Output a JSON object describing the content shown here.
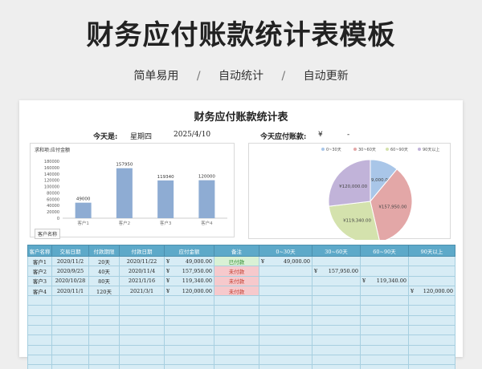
{
  "header": {
    "title": "财务应付账款统计表模板",
    "features": [
      "简单易用",
      "自动统计",
      "自动更新"
    ],
    "separator": "/"
  },
  "sheet": {
    "title": "财务应付账款统计表",
    "today_label": "今天是:",
    "today_weekday": "星期四",
    "today_date": "2025/4/10",
    "due_label": "今天应付账款:",
    "due_currency": "¥",
    "due_value": "-",
    "filter_tag": "客户名称"
  },
  "chart_data": [
    {
      "type": "bar",
      "title": "求和项:应付金额",
      "categories": [
        "客户1",
        "客户2",
        "客户3",
        "客户4"
      ],
      "values": [
        49000,
        157950,
        119340,
        120000
      ],
      "ylim": [
        0,
        180000
      ],
      "yticks": [
        0,
        20000,
        40000,
        60000,
        80000,
        100000,
        120000,
        140000,
        160000,
        180000
      ],
      "grid": false,
      "bar_color": "#8eacd3"
    },
    {
      "type": "pie",
      "legend": [
        "0~30天",
        "30~60天",
        "60~90天",
        "90天以上"
      ],
      "legend_position": "top",
      "values": [
        49000,
        157950,
        119340,
        120000
      ],
      "labels": [
        "¥49,000.00",
        "¥157,950.00",
        "¥119,340.00",
        "¥120,000.00"
      ],
      "colors": [
        "#a9c6e8",
        "#e3a7a7",
        "#d4e2ad",
        "#c1b3d9"
      ],
      "stroke_colors": [
        "#8fb0d8",
        "#d48c8c",
        "#bfd091",
        "#a897c8"
      ]
    }
  ],
  "table": {
    "headers": [
      "客户名称",
      "交易日期",
      "付款期限",
      "付款日期",
      "应付金额",
      "备注",
      "0~30天",
      "30~60天",
      "60~90天",
      "90天以上"
    ],
    "rows": [
      {
        "customer": "客户1",
        "trade_date": "2020/11/2",
        "term": "20天",
        "pay_date": "2020/11/22",
        "amount_cur": "¥",
        "amount": "49,000.00",
        "note": "已付款",
        "note_status": "paid",
        "b1_cur": "¥",
        "b1": "49,000.00",
        "b2_cur": "",
        "b2": "",
        "b3_cur": "",
        "b3": "",
        "b4_cur": "",
        "b4": ""
      },
      {
        "customer": "客户2",
        "trade_date": "2020/9/25",
        "term": "40天",
        "pay_date": "2020/11/4",
        "amount_cur": "¥",
        "amount": "157,950.00",
        "note": "未付款",
        "note_status": "unpaid",
        "b1_cur": "",
        "b1": "",
        "b2_cur": "¥",
        "b2": "157,950.00",
        "b3_cur": "",
        "b3": "",
        "b4_cur": "",
        "b4": ""
      },
      {
        "customer": "客户3",
        "trade_date": "2020/10/28",
        "term": "80天",
        "pay_date": "2021/1/16",
        "amount_cur": "¥",
        "amount": "119,340.00",
        "note": "未付款",
        "note_status": "unpaid",
        "b1_cur": "",
        "b1": "",
        "b2_cur": "",
        "b2": "",
        "b3_cur": "¥",
        "b3": "119,340.00",
        "b4_cur": "",
        "b4": ""
      },
      {
        "customer": "客户4",
        "trade_date": "2020/11/1",
        "term": "120天",
        "pay_date": "2021/3/1",
        "amount_cur": "¥",
        "amount": "120,000.00",
        "note": "未付款",
        "note_status": "unpaid",
        "b1_cur": "",
        "b1": "",
        "b2_cur": "",
        "b2": "",
        "b3_cur": "",
        "b3": "",
        "b4_cur": "¥",
        "b4": "120,000.00"
      }
    ],
    "empty_rows": 8
  }
}
